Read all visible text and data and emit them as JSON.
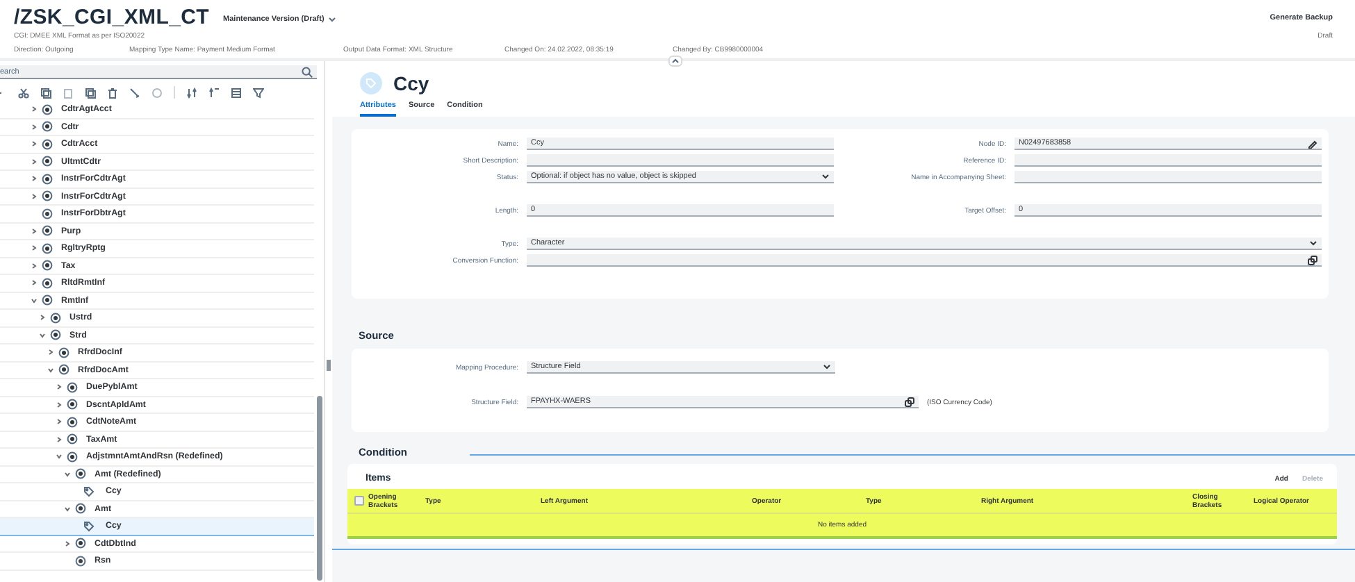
{
  "header": {
    "title": "/ZSK_CGI_XML_CT",
    "version_menu": "Maintenance Version (Draft)",
    "subtitle": "CGI: DMEE XML Format as per ISO20022",
    "attributes": [
      "Direction: Outgoing",
      "Mapping Type Name: Payment Medium Format",
      "Output Data Format: XML Structure",
      "Changed On: 24.02.2022, 08:35:19",
      "Changed By: CB9980000004"
    ],
    "action": "Generate Backup",
    "status": "Draft"
  },
  "search": {
    "placeholder": "earch"
  },
  "tree": [
    {
      "label": "CdtrAgtAcct",
      "kind": "node",
      "expanded": false
    },
    {
      "label": "Cdtr",
      "kind": "node",
      "expanded": false
    },
    {
      "label": "CdtrAcct",
      "kind": "node",
      "expanded": false
    },
    {
      "label": "UltmtCdtr",
      "kind": "node",
      "expanded": false
    },
    {
      "label": "InstrForCdtrAgt",
      "kind": "node",
      "expanded": false
    },
    {
      "label": "InstrForCdtrAgt",
      "kind": "node",
      "expanded": false
    },
    {
      "label": "InstrForDbtrAgt",
      "kind": "leaf"
    },
    {
      "label": "Purp",
      "kind": "node",
      "expanded": false
    },
    {
      "label": "RgltryRptg",
      "kind": "node",
      "expanded": false
    },
    {
      "label": "Tax",
      "kind": "node",
      "expanded": false
    },
    {
      "label": "RltdRmtInf",
      "kind": "node",
      "expanded": false
    },
    {
      "label": "RmtInf",
      "kind": "node",
      "expanded": true,
      "children": [
        {
          "label": "Ustrd",
          "kind": "node",
          "expanded": false
        },
        {
          "label": "Strd",
          "kind": "node",
          "expanded": true,
          "children": [
            {
              "label": "RfrdDocInf",
              "kind": "node",
              "expanded": false
            },
            {
              "label": "RfrdDocAmt",
              "kind": "node",
              "expanded": true,
              "children": [
                {
                  "label": "DuePyblAmt",
                  "kind": "node",
                  "expanded": false
                },
                {
                  "label": "DscntApldAmt",
                  "kind": "node",
                  "expanded": false
                },
                {
                  "label": "CdtNoteAmt",
                  "kind": "node",
                  "expanded": false
                },
                {
                  "label": "TaxAmt",
                  "kind": "node",
                  "expanded": false
                },
                {
                  "label": "AdjstmntAmtAndRsn (Redefined)",
                  "kind": "node",
                  "expanded": true,
                  "children": [
                    {
                      "label": "Amt (Redefined)",
                      "kind": "node",
                      "expanded": true,
                      "children": [
                        {
                          "label": "Ccy",
                          "kind": "attribute",
                          "selected": false
                        }
                      ]
                    },
                    {
                      "label": "Amt",
                      "kind": "node",
                      "expanded": true,
                      "children": [
                        {
                          "label": "Ccy",
                          "kind": "attribute",
                          "selected": true
                        }
                      ]
                    },
                    {
                      "label": "CdtDbtInd",
                      "kind": "node",
                      "expanded": false
                    },
                    {
                      "label": "Rsn",
                      "kind": "leaf"
                    }
                  ]
                }
              ]
            }
          ]
        }
      ]
    }
  ],
  "detail": {
    "title": "Ccy",
    "tabs": [
      {
        "label": "Attributes",
        "selected": true
      },
      {
        "label": "Source",
        "selected": false
      },
      {
        "label": "Condition",
        "selected": false
      }
    ],
    "attributes": {
      "groups": [
        [
          {
            "left": {
              "label": "Name:",
              "value": "Ccy",
              "kind": "text"
            },
            "right": {
              "label": "Node ID:",
              "value": "N02497683858",
              "kind": "edit"
            }
          },
          {
            "left": {
              "label": "Short Description:",
              "kind": "text"
            },
            "right": {
              "label": "Reference ID:",
              "kind": "text"
            }
          },
          {
            "left": {
              "label": "Status:",
              "value": "Optional: if object has no value, object is skipped",
              "kind": "select"
            },
            "right": {
              "label": "Name in Accompanying Sheet:",
              "kind": "text"
            }
          }
        ],
        [
          {
            "left": {
              "label": "Length:",
              "value": "0",
              "kind": "text"
            },
            "right": {
              "label": "Target Offset:",
              "value": "0",
              "kind": "text"
            }
          }
        ],
        [
          {
            "full": {
              "label": "Type:",
              "value": "Character",
              "kind": "select"
            }
          },
          {
            "full": {
              "label": "Conversion Function:",
              "kind": "help"
            }
          }
        ]
      ]
    },
    "source": {
      "title": "Source",
      "fields": [
        {
          "label": "Mapping Procedure:",
          "value": "Structure Field",
          "kind": "select"
        },
        {
          "label": "Structure Field:",
          "value": "FPAYHX-WAERS",
          "kind": "help",
          "note": "(ISO Currency Code)"
        }
      ]
    },
    "condition": {
      "title": "Condition",
      "highlighted": true,
      "table_title": "Items",
      "actions": [
        {
          "label": "Add",
          "disabled": false
        },
        {
          "label": "Delete",
          "disabled": true
        }
      ],
      "columns": [
        "Opening Brackets",
        "Type",
        "Left Argument",
        "Operator",
        "Type",
        "Right Argument",
        "Closing Brackets",
        "Logical Operator"
      ],
      "empty_text": "No items added"
    }
  }
}
